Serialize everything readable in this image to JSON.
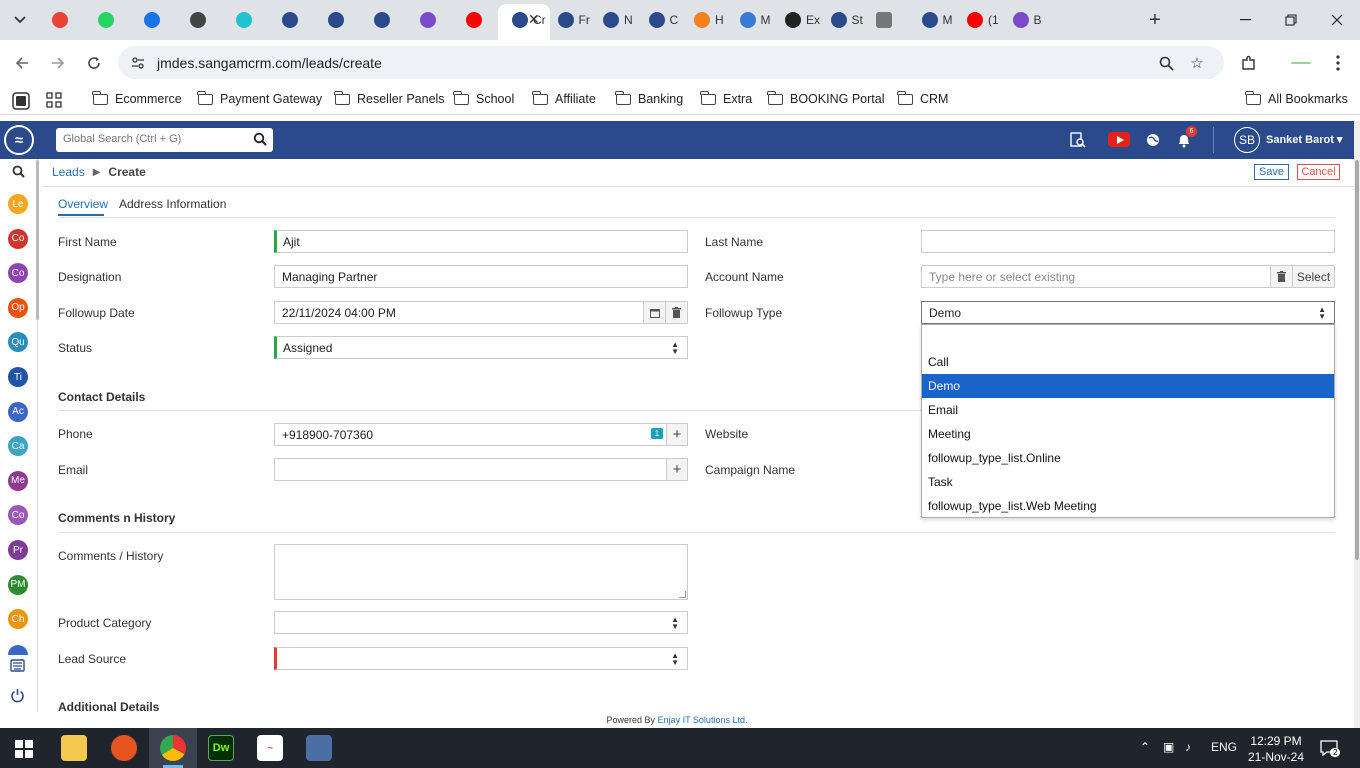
{
  "browser": {
    "tabs": [
      {
        "icon": "gmail-icon",
        "label": ""
      },
      {
        "icon": "whatsapp-icon",
        "label": ""
      },
      {
        "icon": "chat-icon",
        "label": ""
      },
      {
        "icon": "openai-icon",
        "label": ""
      },
      {
        "icon": "canva-icon",
        "label": ""
      },
      {
        "icon": "sangam-icon",
        "label": ""
      },
      {
        "icon": "sangam-icon",
        "label": ""
      },
      {
        "icon": "sangam-icon",
        "label": ""
      },
      {
        "icon": "rocket-icon",
        "label": ""
      },
      {
        "icon": "youtube-icon",
        "label": ""
      },
      {
        "icon": "sangam-icon",
        "label": "Cr"
      },
      {
        "icon": "sangam-icon",
        "label": "Fr"
      },
      {
        "icon": "sangam-icon",
        "label": "N"
      },
      {
        "icon": "sangam-icon",
        "label": "C"
      },
      {
        "icon": "cloudflare-icon",
        "label": "H"
      },
      {
        "icon": "plane-icon",
        "label": "M"
      },
      {
        "icon": "c-icon",
        "label": "Ex"
      },
      {
        "icon": "sangam-icon",
        "label": "St"
      },
      {
        "icon": "gray-square-icon",
        "label": ""
      },
      {
        "icon": "sangam-icon",
        "label": "M"
      },
      {
        "icon": "youtube-icon",
        "label": "(1"
      },
      {
        "icon": "rocket-icon",
        "label": "B"
      }
    ],
    "url": "jmdes.sangamcrm.com/leads/create",
    "bookmarks": [
      "Ecommerce",
      "Payment Gateway",
      "Reseller Panels",
      "School",
      "Affiliate",
      "Banking",
      "Extra",
      "BOOKING Portal",
      "CRM"
    ],
    "all_bookmarks": "All Bookmarks"
  },
  "app": {
    "search_placeholder": "Global Search (Ctrl + G)",
    "notification_count": "6",
    "user_initials": "SB",
    "user_name": "Sanket Barot",
    "nav_items": [
      {
        "label": "Le",
        "color": "#f5a623"
      },
      {
        "label": "Co",
        "color": "#d0342c"
      },
      {
        "label": "Co",
        "color": "#8e44ad"
      },
      {
        "label": "Op",
        "color": "#e8540f"
      },
      {
        "label": "Qu",
        "color": "#2b8cbe"
      },
      {
        "label": "Ti",
        "color": "#2254a6"
      },
      {
        "label": "Ac",
        "color": "#3a66c4"
      },
      {
        "label": "Ca",
        "color": "#3aa6c4"
      },
      {
        "label": "Me",
        "color": "#8e3a8e"
      },
      {
        "label": "Co",
        "color": "#9b59b6"
      },
      {
        "label": "Pr",
        "color": "#7d3c98"
      },
      {
        "label": "PM",
        "color": "#2e8b2e"
      },
      {
        "label": "Ch",
        "color": "#e8960f"
      }
    ],
    "breadcrumb": {
      "parent": "Leads",
      "current": "Create"
    },
    "buttons": {
      "save": "Save",
      "cancel": "Cancel"
    },
    "tabs": {
      "overview": "Overview",
      "address": "Address Information"
    },
    "form": {
      "first_name_label": "First Name",
      "first_name_value": "Ajit",
      "last_name_label": "Last Name",
      "last_name_value": "",
      "designation_label": "Designation",
      "designation_value": "Managing Partner",
      "account_name_label": "Account Name",
      "account_name_placeholder": "Type here or select existing",
      "account_select_label": "Select",
      "followup_date_label": "Followup Date",
      "followup_date_value": "22/11/2024 04:00 PM",
      "followup_type_label": "Followup Type",
      "followup_type_value": "Demo",
      "status_label": "Status",
      "status_value": "Assigned",
      "contact_details_heading": "Contact Details",
      "phone_label": "Phone",
      "phone_value": "+918900-707360",
      "phone_badge": "1",
      "website_label": "Website",
      "email_label": "Email",
      "email_value": "",
      "campaign_label": "Campaign Name",
      "comments_heading": "Comments n History",
      "comments_label": "Comments / History",
      "product_category_label": "Product Category",
      "lead_source_label": "Lead Source",
      "additional_details_heading": "Additional Details"
    },
    "followup_type_options": [
      "",
      "Call",
      "Demo",
      "Email",
      "Meeting",
      "followup_type_list.Online",
      "Task",
      "followup_type_list.Web Meeting"
    ],
    "followup_type_selected_index": 2,
    "footer_prefix": "Powered By",
    "footer_brand": "Enjay IT Solutions Ltd."
  },
  "taskbar": {
    "language": "ENG",
    "time": "12:29 PM",
    "date": "21-Nov-24",
    "notification_count": "2"
  }
}
